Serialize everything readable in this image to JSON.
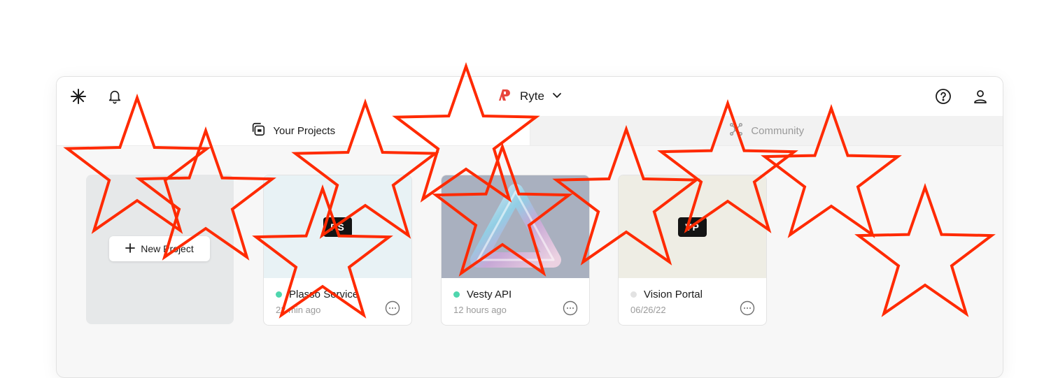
{
  "header": {
    "workspace_name": "Ryte",
    "icons": {
      "left": [
        "asterisk-logo-icon",
        "bell-icon"
      ],
      "right": [
        "help-icon",
        "user-icon"
      ]
    }
  },
  "tabs": [
    {
      "label": "Your Projects",
      "icon": "projects-icon",
      "active": true
    },
    {
      "label": "Community",
      "icon": "community-icon",
      "active": false
    }
  ],
  "new_project": {
    "label": "New Project"
  },
  "projects": [
    {
      "initials": "PS",
      "name": "Plasso Service",
      "time": "22 min ago",
      "status_color": "#4fd6ae",
      "thumb_color": "#e8f2f5"
    },
    {
      "initials": "",
      "name": "Vesty API",
      "time": "12 hours ago",
      "status_color": "#4fd6ae",
      "thumb_color": "#a9b0bf"
    },
    {
      "initials": "VP",
      "name": "Vision Portal",
      "time": "06/26/22",
      "status_color": "#e2e2e2",
      "thumb_color": "#eeede4"
    }
  ],
  "colors": {
    "brand": "#e8453c",
    "star_overlay": "#ff2a00"
  }
}
